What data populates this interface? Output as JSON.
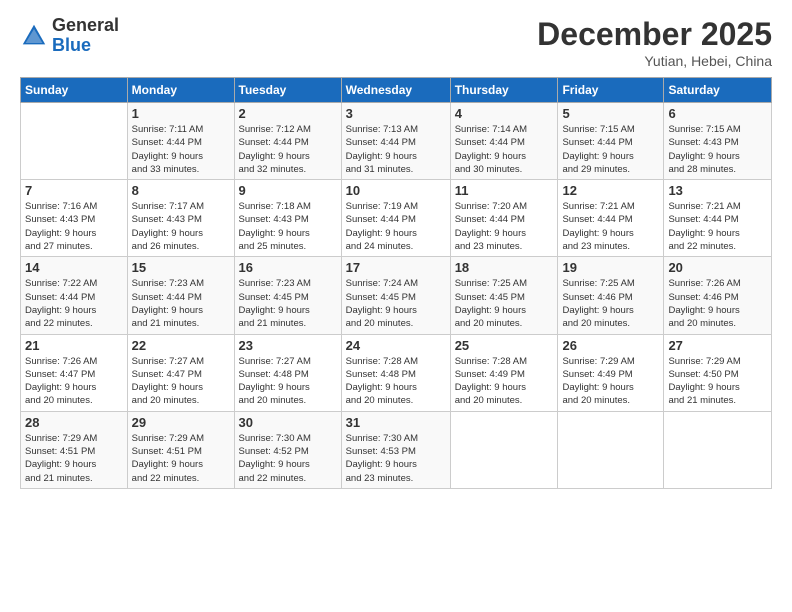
{
  "header": {
    "logo_general": "General",
    "logo_blue": "Blue",
    "month_title": "December 2025",
    "location": "Yutian, Hebei, China"
  },
  "days_of_week": [
    "Sunday",
    "Monday",
    "Tuesday",
    "Wednesday",
    "Thursday",
    "Friday",
    "Saturday"
  ],
  "weeks": [
    [
      {
        "day": "",
        "info": ""
      },
      {
        "day": "1",
        "info": "Sunrise: 7:11 AM\nSunset: 4:44 PM\nDaylight: 9 hours\nand 33 minutes."
      },
      {
        "day": "2",
        "info": "Sunrise: 7:12 AM\nSunset: 4:44 PM\nDaylight: 9 hours\nand 32 minutes."
      },
      {
        "day": "3",
        "info": "Sunrise: 7:13 AM\nSunset: 4:44 PM\nDaylight: 9 hours\nand 31 minutes."
      },
      {
        "day": "4",
        "info": "Sunrise: 7:14 AM\nSunset: 4:44 PM\nDaylight: 9 hours\nand 30 minutes."
      },
      {
        "day": "5",
        "info": "Sunrise: 7:15 AM\nSunset: 4:44 PM\nDaylight: 9 hours\nand 29 minutes."
      },
      {
        "day": "6",
        "info": "Sunrise: 7:15 AM\nSunset: 4:43 PM\nDaylight: 9 hours\nand 28 minutes."
      }
    ],
    [
      {
        "day": "7",
        "info": "Sunrise: 7:16 AM\nSunset: 4:43 PM\nDaylight: 9 hours\nand 27 minutes."
      },
      {
        "day": "8",
        "info": "Sunrise: 7:17 AM\nSunset: 4:43 PM\nDaylight: 9 hours\nand 26 minutes."
      },
      {
        "day": "9",
        "info": "Sunrise: 7:18 AM\nSunset: 4:43 PM\nDaylight: 9 hours\nand 25 minutes."
      },
      {
        "day": "10",
        "info": "Sunrise: 7:19 AM\nSunset: 4:44 PM\nDaylight: 9 hours\nand 24 minutes."
      },
      {
        "day": "11",
        "info": "Sunrise: 7:20 AM\nSunset: 4:44 PM\nDaylight: 9 hours\nand 23 minutes."
      },
      {
        "day": "12",
        "info": "Sunrise: 7:21 AM\nSunset: 4:44 PM\nDaylight: 9 hours\nand 23 minutes."
      },
      {
        "day": "13",
        "info": "Sunrise: 7:21 AM\nSunset: 4:44 PM\nDaylight: 9 hours\nand 22 minutes."
      }
    ],
    [
      {
        "day": "14",
        "info": "Sunrise: 7:22 AM\nSunset: 4:44 PM\nDaylight: 9 hours\nand 22 minutes."
      },
      {
        "day": "15",
        "info": "Sunrise: 7:23 AM\nSunset: 4:44 PM\nDaylight: 9 hours\nand 21 minutes."
      },
      {
        "day": "16",
        "info": "Sunrise: 7:23 AM\nSunset: 4:45 PM\nDaylight: 9 hours\nand 21 minutes."
      },
      {
        "day": "17",
        "info": "Sunrise: 7:24 AM\nSunset: 4:45 PM\nDaylight: 9 hours\nand 20 minutes."
      },
      {
        "day": "18",
        "info": "Sunrise: 7:25 AM\nSunset: 4:45 PM\nDaylight: 9 hours\nand 20 minutes."
      },
      {
        "day": "19",
        "info": "Sunrise: 7:25 AM\nSunset: 4:46 PM\nDaylight: 9 hours\nand 20 minutes."
      },
      {
        "day": "20",
        "info": "Sunrise: 7:26 AM\nSunset: 4:46 PM\nDaylight: 9 hours\nand 20 minutes."
      }
    ],
    [
      {
        "day": "21",
        "info": "Sunrise: 7:26 AM\nSunset: 4:47 PM\nDaylight: 9 hours\nand 20 minutes."
      },
      {
        "day": "22",
        "info": "Sunrise: 7:27 AM\nSunset: 4:47 PM\nDaylight: 9 hours\nand 20 minutes."
      },
      {
        "day": "23",
        "info": "Sunrise: 7:27 AM\nSunset: 4:48 PM\nDaylight: 9 hours\nand 20 minutes."
      },
      {
        "day": "24",
        "info": "Sunrise: 7:28 AM\nSunset: 4:48 PM\nDaylight: 9 hours\nand 20 minutes."
      },
      {
        "day": "25",
        "info": "Sunrise: 7:28 AM\nSunset: 4:49 PM\nDaylight: 9 hours\nand 20 minutes."
      },
      {
        "day": "26",
        "info": "Sunrise: 7:29 AM\nSunset: 4:49 PM\nDaylight: 9 hours\nand 20 minutes."
      },
      {
        "day": "27",
        "info": "Sunrise: 7:29 AM\nSunset: 4:50 PM\nDaylight: 9 hours\nand 21 minutes."
      }
    ],
    [
      {
        "day": "28",
        "info": "Sunrise: 7:29 AM\nSunset: 4:51 PM\nDaylight: 9 hours\nand 21 minutes."
      },
      {
        "day": "29",
        "info": "Sunrise: 7:29 AM\nSunset: 4:51 PM\nDaylight: 9 hours\nand 22 minutes."
      },
      {
        "day": "30",
        "info": "Sunrise: 7:30 AM\nSunset: 4:52 PM\nDaylight: 9 hours\nand 22 minutes."
      },
      {
        "day": "31",
        "info": "Sunrise: 7:30 AM\nSunset: 4:53 PM\nDaylight: 9 hours\nand 23 minutes."
      },
      {
        "day": "",
        "info": ""
      },
      {
        "day": "",
        "info": ""
      },
      {
        "day": "",
        "info": ""
      }
    ]
  ]
}
